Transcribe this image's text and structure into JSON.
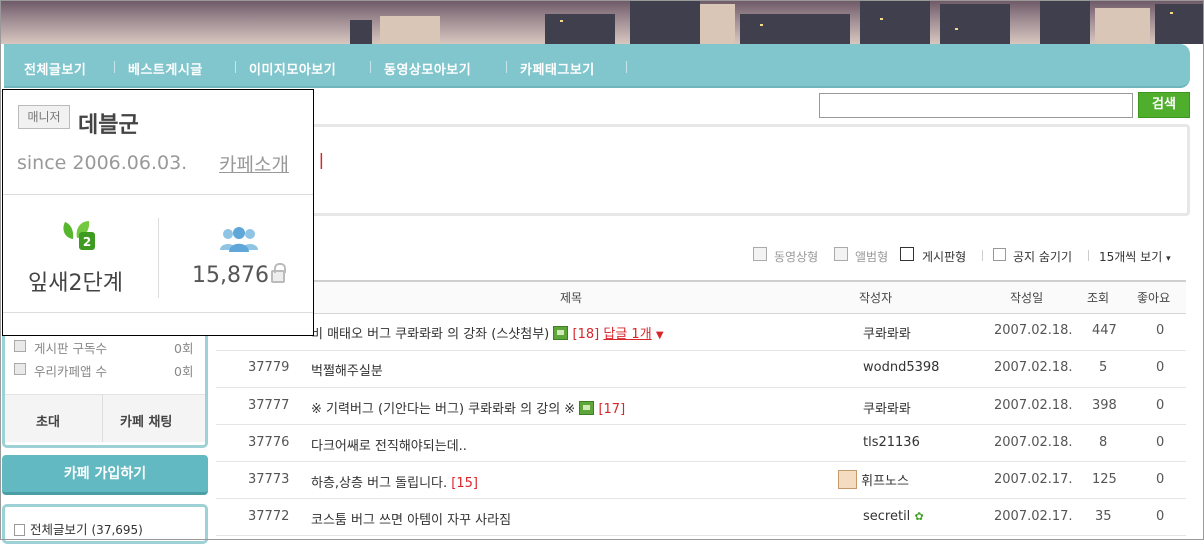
{
  "nav": {
    "items": [
      "전체글보기",
      "베스트게시글",
      "이미지모아보기",
      "동영상모아보기",
      "카페태그보기"
    ]
  },
  "search": {
    "button": "검색",
    "value": ""
  },
  "intro_text": "ㅣ",
  "toolbar": {
    "video_view": "동영상형",
    "album_view": "앨범형",
    "board_view": "게시판형",
    "hide_notice": "공지 숨기기",
    "per_page": "15개씩 보기"
  },
  "table": {
    "headers": {
      "title": "제목",
      "author": "작성자",
      "date": "작성일",
      "views": "조회",
      "likes": "좋아요"
    },
    "rows": [
      {
        "num": "",
        "title": "비 매태오 버그 쿠롸롸롸 의 강좌 (스샷첨부)",
        "comments": "[18]",
        "reply": "답글 1개",
        "author": "쿠롸롸롸",
        "date": "2007.02.18.",
        "views": "447",
        "likes": "0"
      },
      {
        "num": "37779",
        "title": "벅쩔해주실분",
        "comments": "",
        "reply": "",
        "author": "wodnd5398",
        "date": "2007.02.18.",
        "views": "5",
        "likes": "0"
      },
      {
        "num": "37777",
        "title": "※ 기력버그 (기안다는 버그) 쿠롸롸롸 의 강의 ※",
        "comments": "[17]",
        "reply": "",
        "author": "쿠롸롸롸",
        "date": "2007.02.18.",
        "views": "398",
        "likes": "0"
      },
      {
        "num": "37776",
        "title": "다크어쌔로 전직해야되는데..",
        "comments": "",
        "reply": "",
        "author": "tls21136",
        "date": "2007.02.18.",
        "views": "8",
        "likes": "0"
      },
      {
        "num": "37773",
        "title": "하층,상층 버그 돌립니다.",
        "comments": "[15]",
        "reply": "",
        "author": "휘프노스",
        "date": "2007.02.17.",
        "views": "125",
        "likes": "0"
      },
      {
        "num": "37772",
        "title": "코스툼 버그 쓰면 아템이 자꾸 사라짐",
        "comments": "",
        "reply": "",
        "author": "secretil",
        "date": "2007.02.17.",
        "views": "35",
        "likes": "0"
      }
    ]
  },
  "sidebar": {
    "board_subs_label": "게시판 구독수",
    "board_subs_value": "0회",
    "app_label": "우리카페앱 수",
    "app_value": "0회",
    "invite": "초대",
    "chat": "카페 채팅",
    "join": "카페 가입하기",
    "all_posts": "전체글보기",
    "all_posts_count": "(37,695)"
  },
  "popup": {
    "badge": "매니저",
    "name": "데블군",
    "since": "since 2006.06.03.",
    "intro_link": "카페소개",
    "level": "잎새2단계",
    "members": "15,876"
  },
  "colors": {
    "nav": "#82c6cd",
    "accent_red": "#d9262c",
    "search_btn": "#4fae2c"
  }
}
